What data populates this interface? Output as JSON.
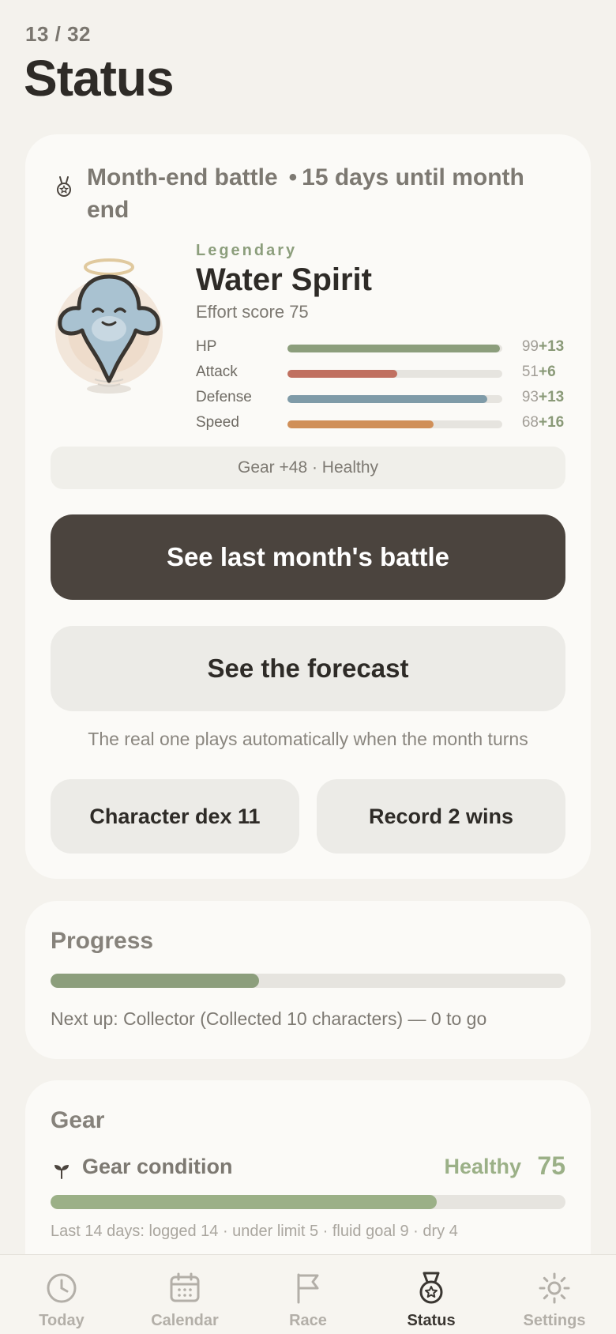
{
  "header": {
    "counter": "13 / 32",
    "title": "Status"
  },
  "battle": {
    "title": "Month-end battle",
    "countdown": "15 days until month end",
    "rarity": "Legendary",
    "character_name": "Water Spirit",
    "effort": "Effort score 75",
    "stats": [
      {
        "label": "HP",
        "value": "99",
        "bonus": "+13",
        "level": 0.99,
        "color": "#8c9e7c"
      },
      {
        "label": "Attack",
        "value": "51",
        "bonus": "+6",
        "level": 0.51,
        "color": "#c07060"
      },
      {
        "label": "Defense",
        "value": "93",
        "bonus": "+13",
        "level": 0.93,
        "color": "#7f9ba8"
      },
      {
        "label": "Speed",
        "value": "68",
        "bonus": "+16",
        "level": 0.68,
        "color": "#d08f58"
      }
    ],
    "gear_pill": "Gear +48 · Healthy",
    "last_battle_button": "See last month's battle",
    "forecast_button": "See the forecast",
    "auto_note": "The real one plays automatically when the month turns",
    "dex_button": "Character dex 11",
    "record_button": "Record 2 wins"
  },
  "progress": {
    "title": "Progress",
    "level": 0.405,
    "next_up": "Next up: Collector (Collected 10 characters) — 0 to go"
  },
  "gear": {
    "title": "Gear",
    "condition_label": "Gear condition",
    "condition_status": "Healthy",
    "condition_score": "75",
    "level": 0.75,
    "summary": "Last 14 days: logged 14 · under limit 5 · fluid goal 9 · dry 4"
  },
  "tabs": [
    {
      "label": "Today",
      "icon": "clock-icon",
      "active": false
    },
    {
      "label": "Calendar",
      "icon": "calendar-icon",
      "active": false
    },
    {
      "label": "Race",
      "icon": "flag-icon",
      "active": false
    },
    {
      "label": "Status",
      "icon": "medal-icon",
      "active": true
    },
    {
      "label": "Settings",
      "icon": "gear-icon",
      "active": false
    }
  ],
  "colors": {
    "accent_green": "#8c9e7c",
    "primary_button": "#4b443e",
    "background": "#f4f2ed"
  }
}
